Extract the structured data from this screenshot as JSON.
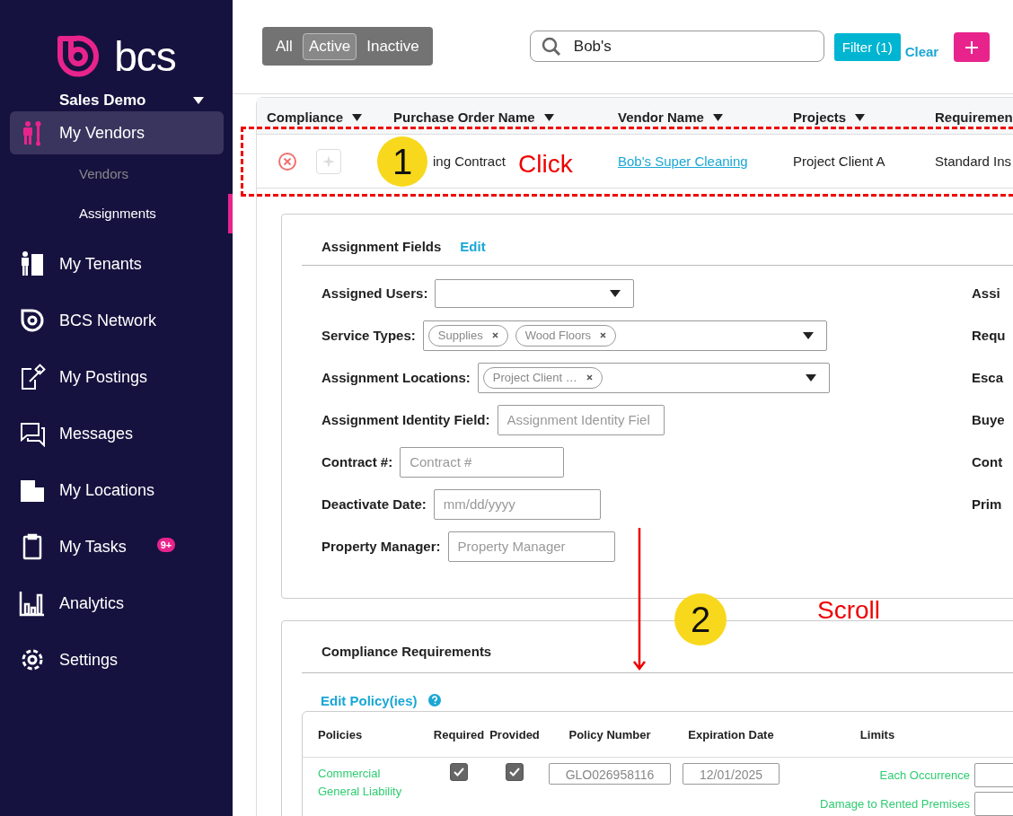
{
  "brand": {
    "name": "bcs",
    "org": "Sales Demo"
  },
  "sidebar": {
    "items": [
      {
        "label": "My Vendors",
        "selected": true,
        "children": [
          {
            "label": "Vendors",
            "selected": false
          },
          {
            "label": "Assignments",
            "selected": true
          }
        ]
      },
      {
        "label": "My Tenants",
        "selected": false
      },
      {
        "label": "BCS Network",
        "selected": false
      },
      {
        "label": "My Postings",
        "selected": false
      },
      {
        "label": "Messages",
        "selected": false
      },
      {
        "label": "My Locations",
        "selected": false
      },
      {
        "label": "My Tasks",
        "selected": false,
        "badge": "9+"
      },
      {
        "label": "Analytics",
        "selected": false
      },
      {
        "label": "Settings",
        "selected": false
      }
    ]
  },
  "status_filter": [
    {
      "label": "All",
      "selected": false
    },
    {
      "label": "Active",
      "selected": true
    },
    {
      "label": "Inactive",
      "selected": false
    }
  ],
  "search": {
    "value": "Bob's"
  },
  "filter_button": "Filter (1)",
  "clear_link": "Clear",
  "table": {
    "columns": [
      "Compliance",
      "Purchase Order Name",
      "Vendor Name",
      "Projects",
      "Requiremen"
    ],
    "rows": [
      {
        "compliant": false,
        "purchase_order": "ing Contract",
        "vendor": "Bob's Super Cleaning",
        "project": "Project Client A",
        "requirement": "Standard Ins"
      }
    ]
  },
  "assignment_fields": {
    "title": "Assignment Fields",
    "edit": "Edit",
    "fields": [
      {
        "label": "Assigned Users:",
        "kind": "select"
      },
      {
        "label": "Service Types:",
        "kind": "tags",
        "tags": [
          "Supplies",
          "Wood Floors"
        ]
      },
      {
        "label": "Assignment Locations:",
        "kind": "tags",
        "tags": [
          "Project Client …"
        ]
      },
      {
        "label": "Assignment Identity Field:",
        "kind": "text",
        "placeholder": "Assignment Identity Fiel"
      },
      {
        "label": "Contract #:",
        "kind": "text",
        "placeholder": "Contract #"
      },
      {
        "label": "Deactivate Date:",
        "kind": "text",
        "placeholder": "mm/dd/yyyy"
      },
      {
        "label": "Property Manager:",
        "kind": "text",
        "placeholder": "Property Manager"
      }
    ],
    "right_labels": [
      "Assi",
      "Requ",
      "Esca",
      "Buye",
      "Cont",
      "Prim"
    ]
  },
  "compliance": {
    "title": "Compliance Requirements",
    "edit_link": "Edit Policy(ies)",
    "columns": [
      "Policies",
      "Required",
      "Provided",
      "Policy Number",
      "Expiration Date",
      "Limits"
    ],
    "rows": [
      {
        "policy": "Commercial General Liability",
        "required": true,
        "provided": true,
        "policy_number": "GLO026958116",
        "expiration": "12/01/2025",
        "limits": [
          "Each Occurrence",
          "Damage to Rented Premises"
        ]
      }
    ]
  },
  "annotations": [
    {
      "number": "1",
      "label": "Click"
    },
    {
      "number": "2",
      "label": "Scroll"
    }
  ]
}
